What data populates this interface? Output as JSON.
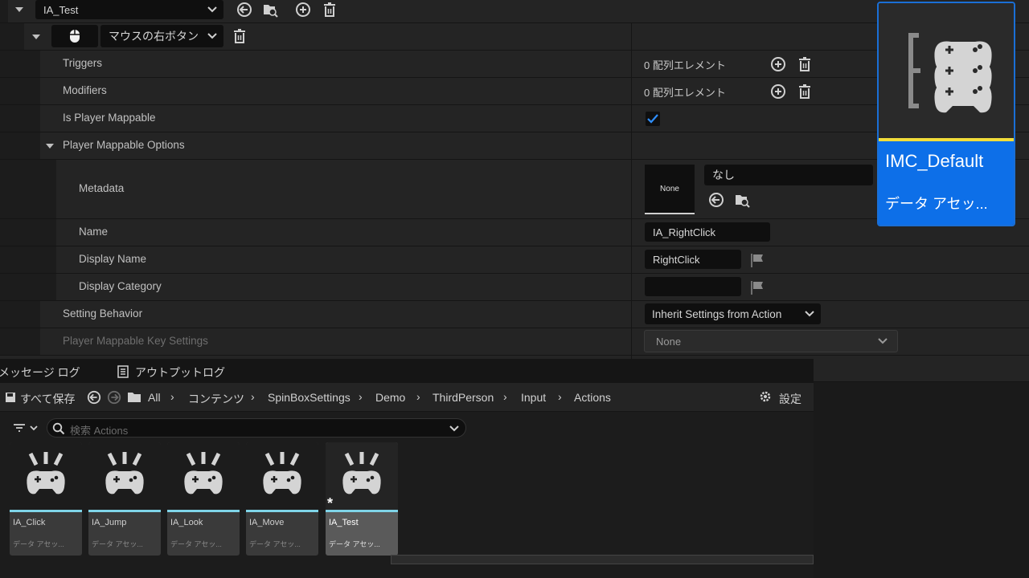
{
  "details": {
    "action_row": {
      "value": "IA_Test"
    },
    "key_row": {
      "key_label": "マウスの右ボタン"
    },
    "rows": {
      "triggers": {
        "label": "Triggers",
        "value": "0 配列エレメント"
      },
      "modifiers": {
        "label": "Modifiers",
        "value": "0 配列エレメント"
      },
      "is_player_mappable": {
        "label": "Is Player Mappable",
        "checked": true
      },
      "player_mappable_options": {
        "label": "Player Mappable Options"
      },
      "metadata": {
        "label": "Metadata",
        "thumb_text": "None",
        "value": "なし"
      },
      "name": {
        "label": "Name",
        "value": "IA_RightClick"
      },
      "display_name": {
        "label": "Display Name",
        "value": "RightClick"
      },
      "display_category": {
        "label": "Display Category",
        "value": ""
      },
      "setting_behavior": {
        "label": "Setting Behavior",
        "value": "Inherit Settings from Action"
      },
      "player_mappable_key_settings": {
        "label": "Player Mappable Key Settings",
        "value": "None"
      }
    }
  },
  "imc_card": {
    "name": "IMC_Default",
    "type": "データ アセッ..."
  },
  "content_browser": {
    "tabs": {
      "message_log": "メッセージ ログ",
      "output_log": "アウトプットログ"
    },
    "save_all": "すべて保存",
    "breadcrumbs": [
      "All",
      "コンテンツ",
      "SpinBoxSettings",
      "Demo",
      "ThirdPerson",
      "Input",
      "Actions"
    ],
    "settings_label": "設定",
    "search_placeholder": "検索 Actions",
    "assets": [
      {
        "name": "IA_Click",
        "type": "データ アセッ..."
      },
      {
        "name": "IA_Jump",
        "type": "データ アセッ..."
      },
      {
        "name": "IA_Look",
        "type": "データ アセッ..."
      },
      {
        "name": "IA_Move",
        "type": "データ アセッ..."
      },
      {
        "name": "IA_Test",
        "type": "データ アセッ...",
        "modified_marker": "*"
      }
    ]
  }
}
